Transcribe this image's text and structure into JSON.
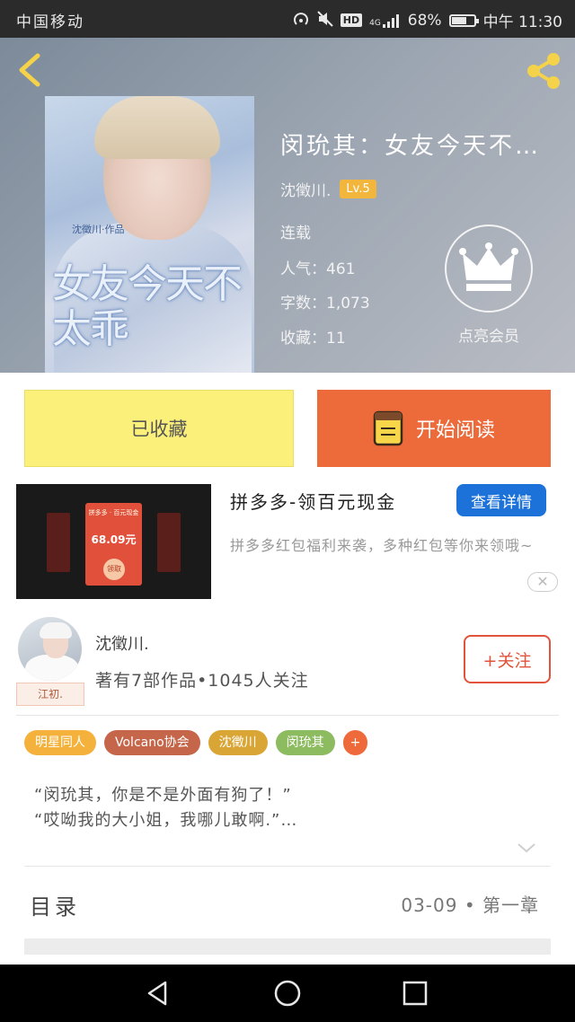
{
  "status_bar": {
    "carrier": "中国移动",
    "network": "4G",
    "hd": "HD",
    "battery_pct": "68%",
    "battery_level": 0.68,
    "time": "中午 11:30"
  },
  "book": {
    "title": "闵玧其：女友今天不…",
    "author": "沈徵川.",
    "level": "Lv.5",
    "status": "连载",
    "popularity_label": "人气：461",
    "word_count_label": "字数：1,073",
    "favorites_label": "收藏：11",
    "cover_title": "女友今天不太乖",
    "cover_sub": "沈徵川·作品"
  },
  "vip": {
    "label": "点亮会员"
  },
  "actions": {
    "favorited_label": "已收藏",
    "start_reading_label": "开始阅读"
  },
  "ad": {
    "title": "拼多多-领百元现金",
    "button": "查看详情",
    "description": "拼多多红包福利来袭，多种红包等你来领哦~",
    "card_header": "拼多多 · 百元现金",
    "amount": "68.09元",
    "claim": "领取"
  },
  "author_card": {
    "name": "沈徵川.",
    "stats": "著有7部作品•1045人关注",
    "avatar_tag": "江初.",
    "follow_label": "+关注"
  },
  "tags": [
    {
      "label": "明星同人",
      "color": "#f4b23c"
    },
    {
      "label": "Volcano协会",
      "color": "#c5664a"
    },
    {
      "label": "沈徵川",
      "color": "#d9a636"
    },
    {
      "label": "闵玧其",
      "color": "#8dbb5f"
    },
    {
      "label": "+",
      "color": "#ef6a3a"
    }
  ],
  "excerpt": {
    "line1": "“闵玧其，你是不是外面有狗了！”",
    "line2": "“哎呦我的大小姐，我哪儿敢啊.”…"
  },
  "toc": {
    "label": "目录",
    "latest": "03-09 • 第一章"
  },
  "colors": {
    "accent_yellow": "#fbf07a",
    "accent_orange": "#ed6a3b",
    "link_blue": "#1d72d9",
    "follow_red": "#e2533b"
  }
}
